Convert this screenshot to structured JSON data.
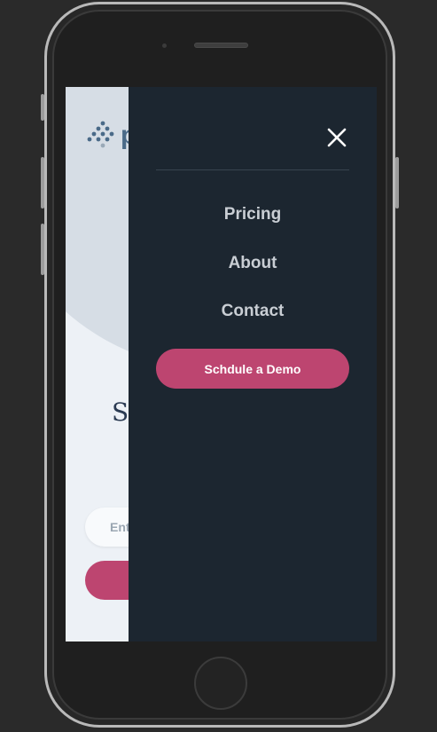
{
  "page": {
    "hero_heading_fragment": "S",
    "logo_letter": "p",
    "email_placeholder": "Ent"
  },
  "menu": {
    "items": [
      {
        "label": "Pricing"
      },
      {
        "label": "About"
      },
      {
        "label": "Contact"
      }
    ],
    "cta_label": "Schdule a Demo",
    "close_icon": "close-icon"
  },
  "colors": {
    "overlay_bg": "#1c2630",
    "accent": "#bd4570",
    "menu_text": "#c9ced4",
    "page_bg": "#edf1f6",
    "brand_blue": "#4a6a88"
  }
}
